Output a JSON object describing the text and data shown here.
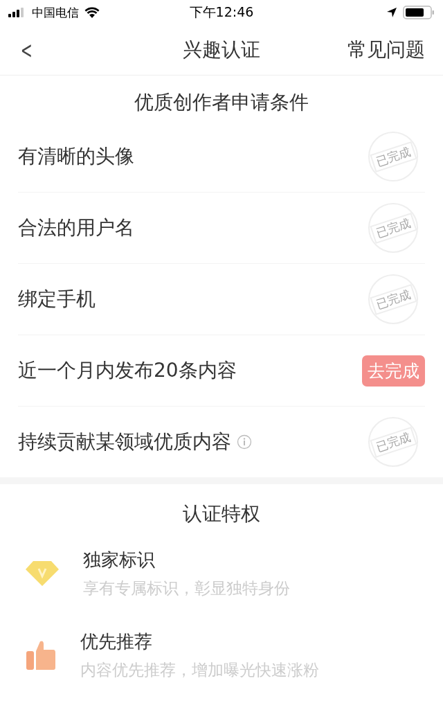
{
  "status_bar": {
    "carrier": "中国电信",
    "time": "下午12:46"
  },
  "nav": {
    "back": "<",
    "title": "兴趣认证",
    "action": "常见问题"
  },
  "conditions": {
    "title": "优质创作者申请条件",
    "items": [
      {
        "label": "有清晰的头像",
        "kind": "done",
        "status": "已完成",
        "info": false
      },
      {
        "label": "合法的用户名",
        "kind": "done",
        "status": "已完成",
        "info": false
      },
      {
        "label": "绑定手机",
        "kind": "done",
        "status": "已完成",
        "info": false
      },
      {
        "label": "近一个月内发布20条内容",
        "kind": "todo",
        "status": "去完成",
        "info": false
      },
      {
        "label": "持续贡献某领域优质内容",
        "kind": "done",
        "status": "已完成",
        "info": true
      }
    ]
  },
  "privileges": {
    "title": "认证特权",
    "items": [
      {
        "kind": "diamond",
        "name": "独家标识",
        "desc": "享有专属标识，彰显独特身份"
      },
      {
        "kind": "thumb",
        "name": "优先推荐",
        "desc": "内容优先推荐，增加曝光快速涨粉"
      }
    ]
  }
}
